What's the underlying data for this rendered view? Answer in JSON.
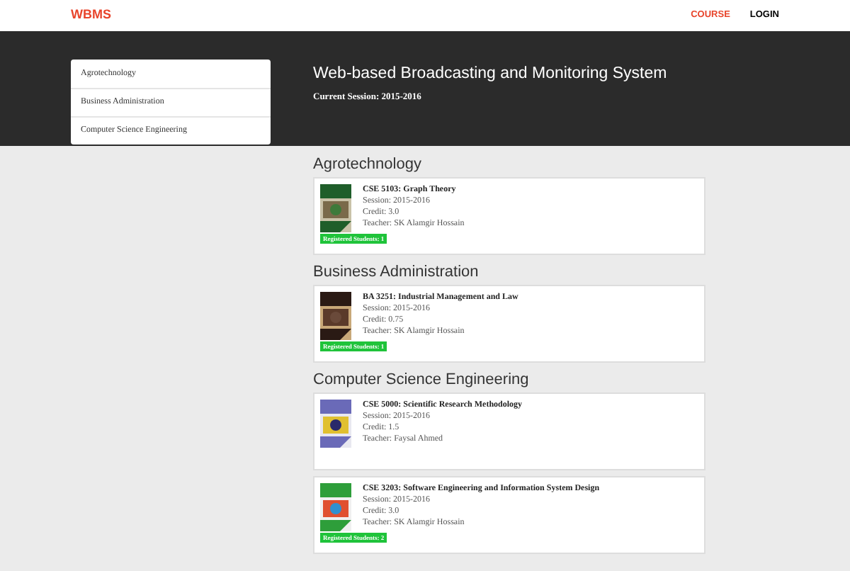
{
  "nav": {
    "brand": "WBMS",
    "links": [
      {
        "label": "COURSE",
        "selected": true
      },
      {
        "label": "LOGIN",
        "selected": false
      }
    ]
  },
  "sidebar": {
    "items": [
      "Agrotechnology",
      "Business Administration",
      "Computer Science Engineering"
    ]
  },
  "banner": {
    "title": "Web-based Broadcasting and Monitoring System",
    "session": "Current Session: 2015-2016"
  },
  "departments": [
    {
      "name": "Agrotechnology",
      "courses": [
        {
          "title": "CSE 5103: Graph Theory",
          "session": "Session: 2015-2016",
          "credit": "Credit: 3.0",
          "teacher": "Teacher: SK Alamgir Hossain",
          "badge": "Registered Students: 1"
        }
      ]
    },
    {
      "name": "Business Administration",
      "courses": [
        {
          "title": "BA 3251: Industrial Management and Law",
          "session": "Session: 2015-2016",
          "credit": "Credit: 0.75",
          "teacher": "Teacher: SK Alamgir Hossain",
          "badge": "Registered Students: 1"
        }
      ]
    },
    {
      "name": "Computer Science Engineering",
      "courses": [
        {
          "title": "CSE 5000: Scientific Research Methodology",
          "session": "Session: 2015-2016",
          "credit": "Credit: 1.5",
          "teacher": "Teacher: Faysal Ahmed"
        },
        {
          "title": "CSE 3203: Software Engineering and Information System Design",
          "session": "Session: 2015-2016",
          "credit": "Credit: 3.0",
          "teacher": "Teacher: SK Alamgir Hossain",
          "badge": "Registered Students: 2"
        }
      ]
    }
  ]
}
